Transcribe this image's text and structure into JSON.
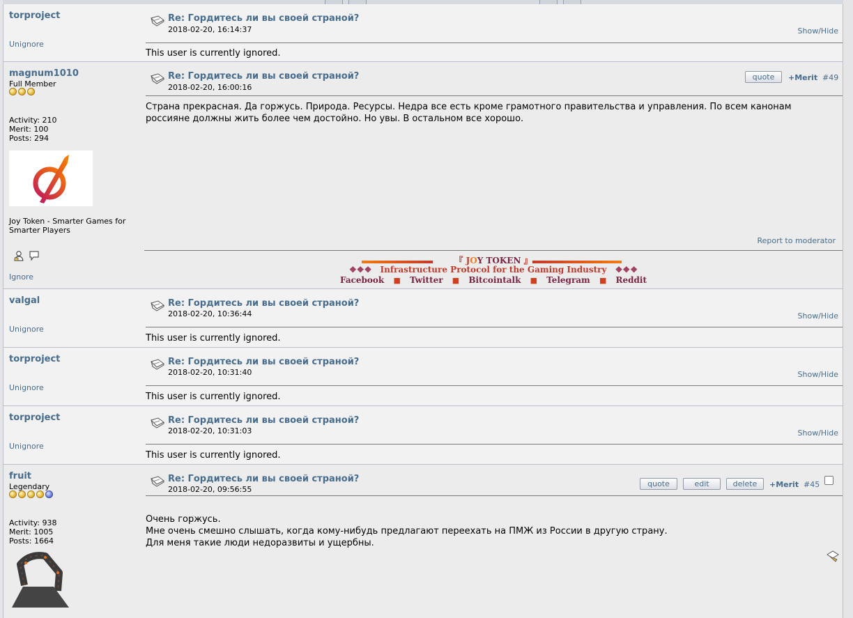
{
  "posts": [
    {
      "username": "torproject",
      "subject": "Re: Гордитесь ли вы своей страной?",
      "date": "2018-02-20, 16:14:37",
      "show_hide": "Show/Hide",
      "ignored_text": "This user is currently ignored.",
      "unignore": "Unignore"
    },
    {
      "username": "magnum1010",
      "rank": "Full Member",
      "stars": 3,
      "activity": "Activity: 210",
      "merit": "Merit: 100",
      "posts": "Posts: 294",
      "personal_text": "Joy Token - Smarter Games for Smarter Players",
      "ignore": "Ignore",
      "subject": "Re: Гордитесь ли вы своей страной?",
      "date": "2018-02-20, 16:00:16",
      "quote_label": "quote",
      "merit_label": "+Merit",
      "post_number": "#49",
      "body": "Страна прекрасная. Да горжусь. Природа. Ресурсы. Недра все есть кроме грамотного правительства и управления. По всем канонам россияне должны жить более чем достойно. Но увы. В остальном все хорошо.",
      "report": "Report to moderator",
      "signature": {
        "title_left": "『",
        "title_j": "J",
        "title_o": "O",
        "title_rest": "Y TOKEN",
        "title_right": "』",
        "diamonds": "❖❖❖",
        "tagline": "Infrastructure Protocol for the Gaming Industry",
        "links": [
          "Facebook",
          "Twitter",
          "Bitcointalk",
          "Telegram",
          "Reddit"
        ],
        "separator": "■"
      }
    },
    {
      "username": "valgal",
      "subject": "Re: Гордитесь ли вы своей страной?",
      "date": "2018-02-20, 10:36:44",
      "show_hide": "Show/Hide",
      "ignored_text": "This user is currently ignored.",
      "unignore": "Unignore"
    },
    {
      "username": "torproject",
      "subject": "Re: Гордитесь ли вы своей страной?",
      "date": "2018-02-20, 10:31:40",
      "show_hide": "Show/Hide",
      "ignored_text": "This user is currently ignored.",
      "unignore": "Unignore"
    },
    {
      "username": "torproject",
      "subject": "Re: Гордитесь ли вы своей страной?",
      "date": "2018-02-20, 10:31:03",
      "show_hide": "Show/Hide",
      "ignored_text": "This user is currently ignored.",
      "unignore": "Unignore"
    },
    {
      "username": "fruit",
      "rank": "Legendary",
      "stars": 5,
      "activity": "Activity: 938",
      "merit": "Merit: 1005",
      "posts": "Posts: 1664",
      "subject": "Re: Гордитесь ли вы своей страной?",
      "date": "2018-02-20, 09:56:55",
      "quote_label": "quote",
      "edit_label": "edit",
      "delete_label": "delete",
      "merit_label": "+Merit",
      "post_number": "#45",
      "body_lines": [
        "Очень горжусь.",
        "Мне очень смешно слышать, когда кому-нибудь предлагают переехать на ПМЖ из России в другую страну.",
        "Для меня такие люди недоразвиты и ущербны."
      ]
    }
  ],
  "colors": {
    "link": "#476c8e",
    "signature_red": "#c0392b",
    "signature_dark": "#7a2340",
    "signature_orange": "#f07b13"
  }
}
